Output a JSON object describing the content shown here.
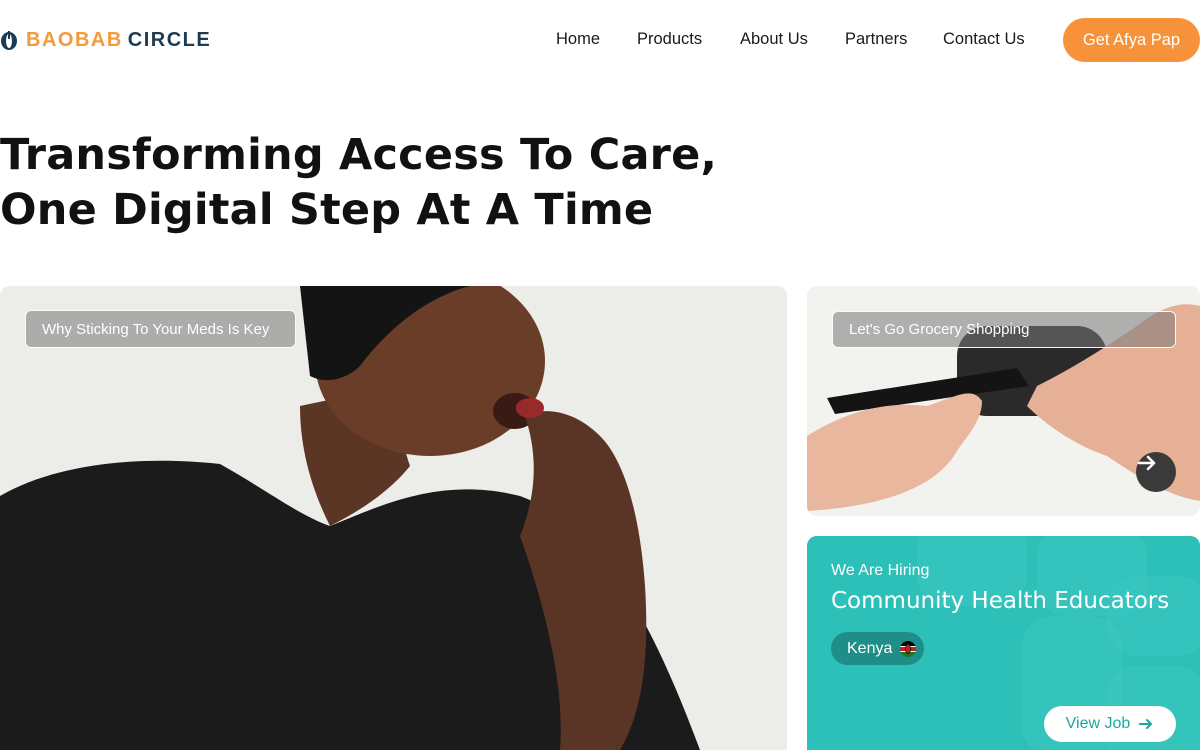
{
  "header": {
    "logo_part1": "BAOBAB",
    "logo_part2": "CIRCLE",
    "nav": [
      "Home",
      "Products",
      "About Us",
      "Partners",
      "Contact Us"
    ],
    "cta_label": "Get Afya Pap"
  },
  "hero": {
    "title_line1": "Transforming Access To Care,",
    "title_line2": "One Digital Step At A Time"
  },
  "cards": {
    "featured_label": "Why Sticking To Your Meds Is Key",
    "secondary_label": "Let's Go Grocery Shopping",
    "next_icon": "arrow-right-icon"
  },
  "hiring": {
    "kicker": "We Are Hiring",
    "title": "Community Health Educators",
    "country": "Kenya",
    "button_label": "View Job"
  },
  "colors": {
    "brand_orange": "#f7913a",
    "brand_navy": "#1d3b52",
    "teal": "#2cc0b8"
  }
}
